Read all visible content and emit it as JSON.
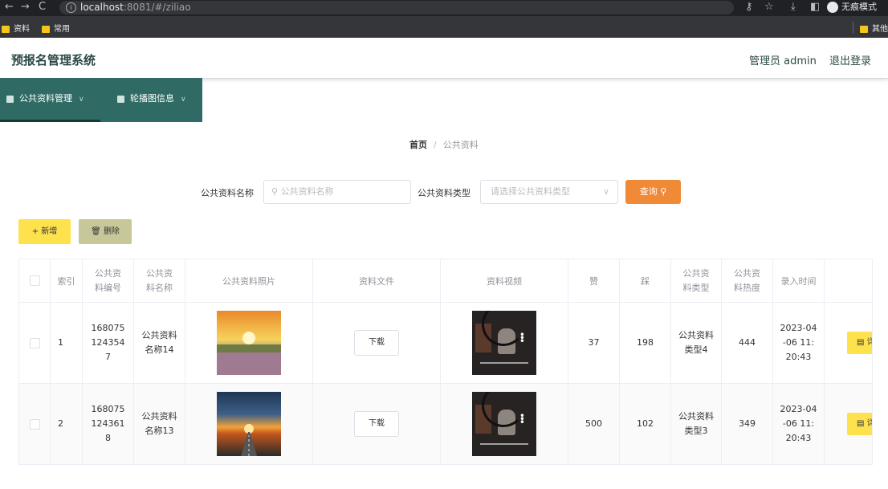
{
  "browser": {
    "url_host": "localhost",
    "url_rest": ":8081/#/ziliao",
    "incognito_label": "无痕模式",
    "bookmarks": [
      "资料",
      "常用"
    ],
    "other_bookmarks": "其他"
  },
  "header": {
    "title": "预报名管理系统",
    "admin_label": "管理员 admin",
    "logout_label": "退出登录"
  },
  "nav": {
    "items": [
      {
        "label": "公共资料管理"
      },
      {
        "label": "轮播图信息"
      }
    ]
  },
  "breadcrumb": {
    "home": "首页",
    "separator": "/",
    "current": "公共资料"
  },
  "search": {
    "name_label": "公共资料名称",
    "name_placeholder": "公共资料名称",
    "type_label": "公共资料类型",
    "type_placeholder": "请选择公共资料类型",
    "button_label": "查询"
  },
  "actions": {
    "add_label": "新增",
    "delete_label": "删除"
  },
  "table": {
    "headers": {
      "index": "索引",
      "code": "公共资料编号",
      "name": "公共资料名称",
      "photo": "公共资料照片",
      "file": "资料文件",
      "video": "资料视频",
      "like": "赞",
      "dislike": "踩",
      "type": "公共资料类型",
      "heat": "公共资料热度",
      "time": "录入时间"
    },
    "download_label": "下载",
    "detail_label": "详",
    "rows": [
      {
        "index": "1",
        "code": "1680751243547",
        "name": "公共资料名称14",
        "like": "37",
        "dislike": "198",
        "type": "公共资料类型4",
        "heat": "444",
        "time": "2023-04-06 11:20:43"
      },
      {
        "index": "2",
        "code": "1680751243618",
        "name": "公共资料名称13",
        "like": "500",
        "dislike": "102",
        "type": "公共资料类型3",
        "heat": "349",
        "time": "2023-04-06 11:20:43"
      }
    ]
  },
  "colors": {
    "nav_bg": "#2f6b64",
    "search_button": "#f08a36",
    "add_button": "#fde14d",
    "delete_button": "#c8c79a"
  }
}
